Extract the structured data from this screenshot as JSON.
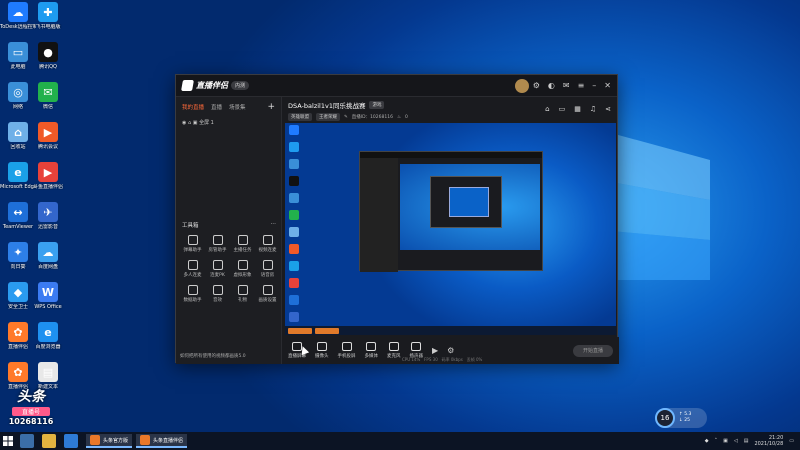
{
  "desktop_icons": [
    {
      "label": "ToDesk远程控制",
      "color": "#1f7bff",
      "glyph": "☁"
    },
    {
      "label": "飞书电脑版",
      "color": "#1e9bf0",
      "glyph": "✚"
    },
    {
      "label": "此电脑",
      "color": "#3a8fd8",
      "glyph": "▭"
    },
    {
      "label": "腾讯QQ",
      "color": "#111111",
      "glyph": "●"
    },
    {
      "label": "网络",
      "color": "#3a8fd8",
      "glyph": "◎"
    },
    {
      "label": "微信",
      "color": "#22b14c",
      "glyph": "✉"
    },
    {
      "label": "回收站",
      "color": "#6fb0e8",
      "glyph": "⌂"
    },
    {
      "label": "腾讯会议",
      "color": "#f05a28",
      "glyph": "▶"
    },
    {
      "label": "Microsoft Edge",
      "color": "#1aa0e8",
      "glyph": "e"
    },
    {
      "label": "斗鱼直播伴侣",
      "color": "#e8423a",
      "glyph": "▶"
    },
    {
      "label": "TeamViewer",
      "color": "#1e6fd8",
      "glyph": "↔"
    },
    {
      "label": "迅雷影音",
      "color": "#3366cc",
      "glyph": "✈"
    },
    {
      "label": "向日葵",
      "color": "#2d7fe8",
      "glyph": "✦"
    },
    {
      "label": "百度网盘",
      "color": "#3aa0f0",
      "glyph": "☁"
    },
    {
      "label": "安全卫士",
      "color": "#2a9bf0",
      "glyph": "◆"
    },
    {
      "label": "WPS Office",
      "color": "#3b7bf2",
      "glyph": "W"
    },
    {
      "label": "直播伴侣",
      "color": "#ff7a2a",
      "glyph": "✿"
    },
    {
      "label": "百度浏览器",
      "color": "#1e90f0",
      "glyph": "e"
    },
    {
      "label": "直播伴侣",
      "color": "#ff7a2a",
      "glyph": "✿"
    },
    {
      "label": "新建文本",
      "color": "#e8e8e8",
      "glyph": "▤"
    }
  ],
  "window": {
    "app_name": "直播伴侣",
    "edition_tag": "内测",
    "left_tabs": [
      "我的直播",
      "直播",
      "场景集"
    ],
    "scene_item": "全屏 1",
    "tools_title": "工具箱",
    "tools": [
      "弹幕助手",
      "房管助手",
      "主播任务",
      "视频连麦",
      "多人连麦",
      "连麦PK",
      "虚拟形象",
      "语音房",
      "数据助手",
      "音效",
      "礼物",
      "画质设置"
    ],
    "notice": "如何把所有使用的视频都画质5.0",
    "stream_title": "DSA-balzil1v1同乐挑战赛",
    "stream_badge": "游戏",
    "sub_chips": [
      "英雄联盟",
      "王者荣耀"
    ],
    "sub_stats": "直播ID：10268116",
    "sub_count": "0",
    "controls": [
      "直播屏幕",
      "摄像头",
      "手机投屏",
      "多媒体",
      "麦克风",
      "扬声器"
    ],
    "start_label": "开始直播",
    "status_items": [
      "CPU 14%",
      "FPS 30",
      "码率 0kbps",
      "丢帧 0%"
    ]
  },
  "taskbar": {
    "apps": [
      "头条官方版",
      "头条直播伴侣"
    ],
    "time": "21:20",
    "date": "2021/10/28"
  },
  "network_widget": {
    "percent": "16",
    "up": "5.3",
    "down": "25"
  },
  "watermark": {
    "line1": "头条",
    "line2": "直播号",
    "line3": "10268116"
  }
}
